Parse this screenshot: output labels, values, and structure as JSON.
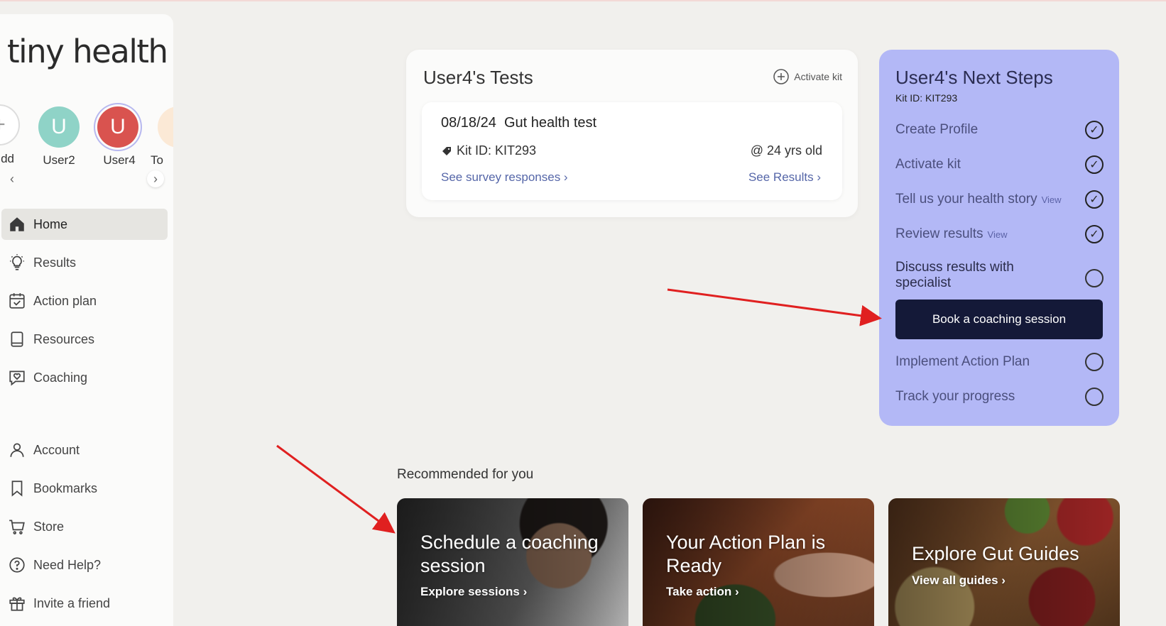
{
  "brand": {
    "logo": "tiny health"
  },
  "profiles": [
    {
      "initial": "+",
      "name": "dd",
      "color": "#ffffff"
    },
    {
      "initial": "U",
      "name": "User2",
      "color": "#8fd3c7"
    },
    {
      "initial": "U",
      "name": "User4",
      "color": "#d9534f"
    },
    {
      "initial": "",
      "name": "To",
      "color": "#fbe9d6"
    }
  ],
  "sidebar": {
    "items": [
      {
        "label": "Home",
        "icon": "home-icon"
      },
      {
        "label": "Results",
        "icon": "lightbulb-icon"
      },
      {
        "label": "Action plan",
        "icon": "calendar-check-icon"
      },
      {
        "label": "Resources",
        "icon": "book-icon"
      },
      {
        "label": "Coaching",
        "icon": "chat-heart-icon"
      },
      {
        "label": "Account",
        "icon": "user-icon"
      },
      {
        "label": "Bookmarks",
        "icon": "bookmark-icon"
      },
      {
        "label": "Store",
        "icon": "cart-icon"
      },
      {
        "label": "Need Help?",
        "icon": "help-icon"
      },
      {
        "label": "Invite a friend",
        "icon": "gift-icon"
      }
    ]
  },
  "tests": {
    "title": "User4's Tests",
    "activate_label": "Activate kit",
    "card": {
      "date": "08/18/24",
      "name": "Gut health test",
      "kit": "Kit ID: KIT293",
      "age": "@ 24 yrs old",
      "survey_link": "See survey responses ›",
      "results_link": "See Results ›"
    }
  },
  "next_steps": {
    "title": "User4's Next Steps",
    "kit": "Kit ID: KIT293",
    "items": [
      {
        "label": "Create Profile",
        "view": ""
      },
      {
        "label": "Activate kit",
        "view": ""
      },
      {
        "label": "Tell us your health story",
        "view": "View"
      },
      {
        "label": "Review results",
        "view": "View"
      },
      {
        "label": "Discuss results with specialist",
        "view": ""
      },
      {
        "label": "Implement Action Plan",
        "view": ""
      },
      {
        "label": "Track your progress",
        "view": ""
      }
    ],
    "book_button": "Book a coaching session"
  },
  "recommended": {
    "title": "Recommended for you",
    "cards": [
      {
        "title": "Schedule a coaching session",
        "link": "Explore sessions ›"
      },
      {
        "title": "Your Action Plan is Ready",
        "link": "Take action ›"
      },
      {
        "title": "Explore Gut Guides",
        "link": "View all guides ›"
      }
    ]
  },
  "colors": {
    "accent": "#b3b8f6",
    "button": "#141938",
    "annotation": "#e02020"
  }
}
